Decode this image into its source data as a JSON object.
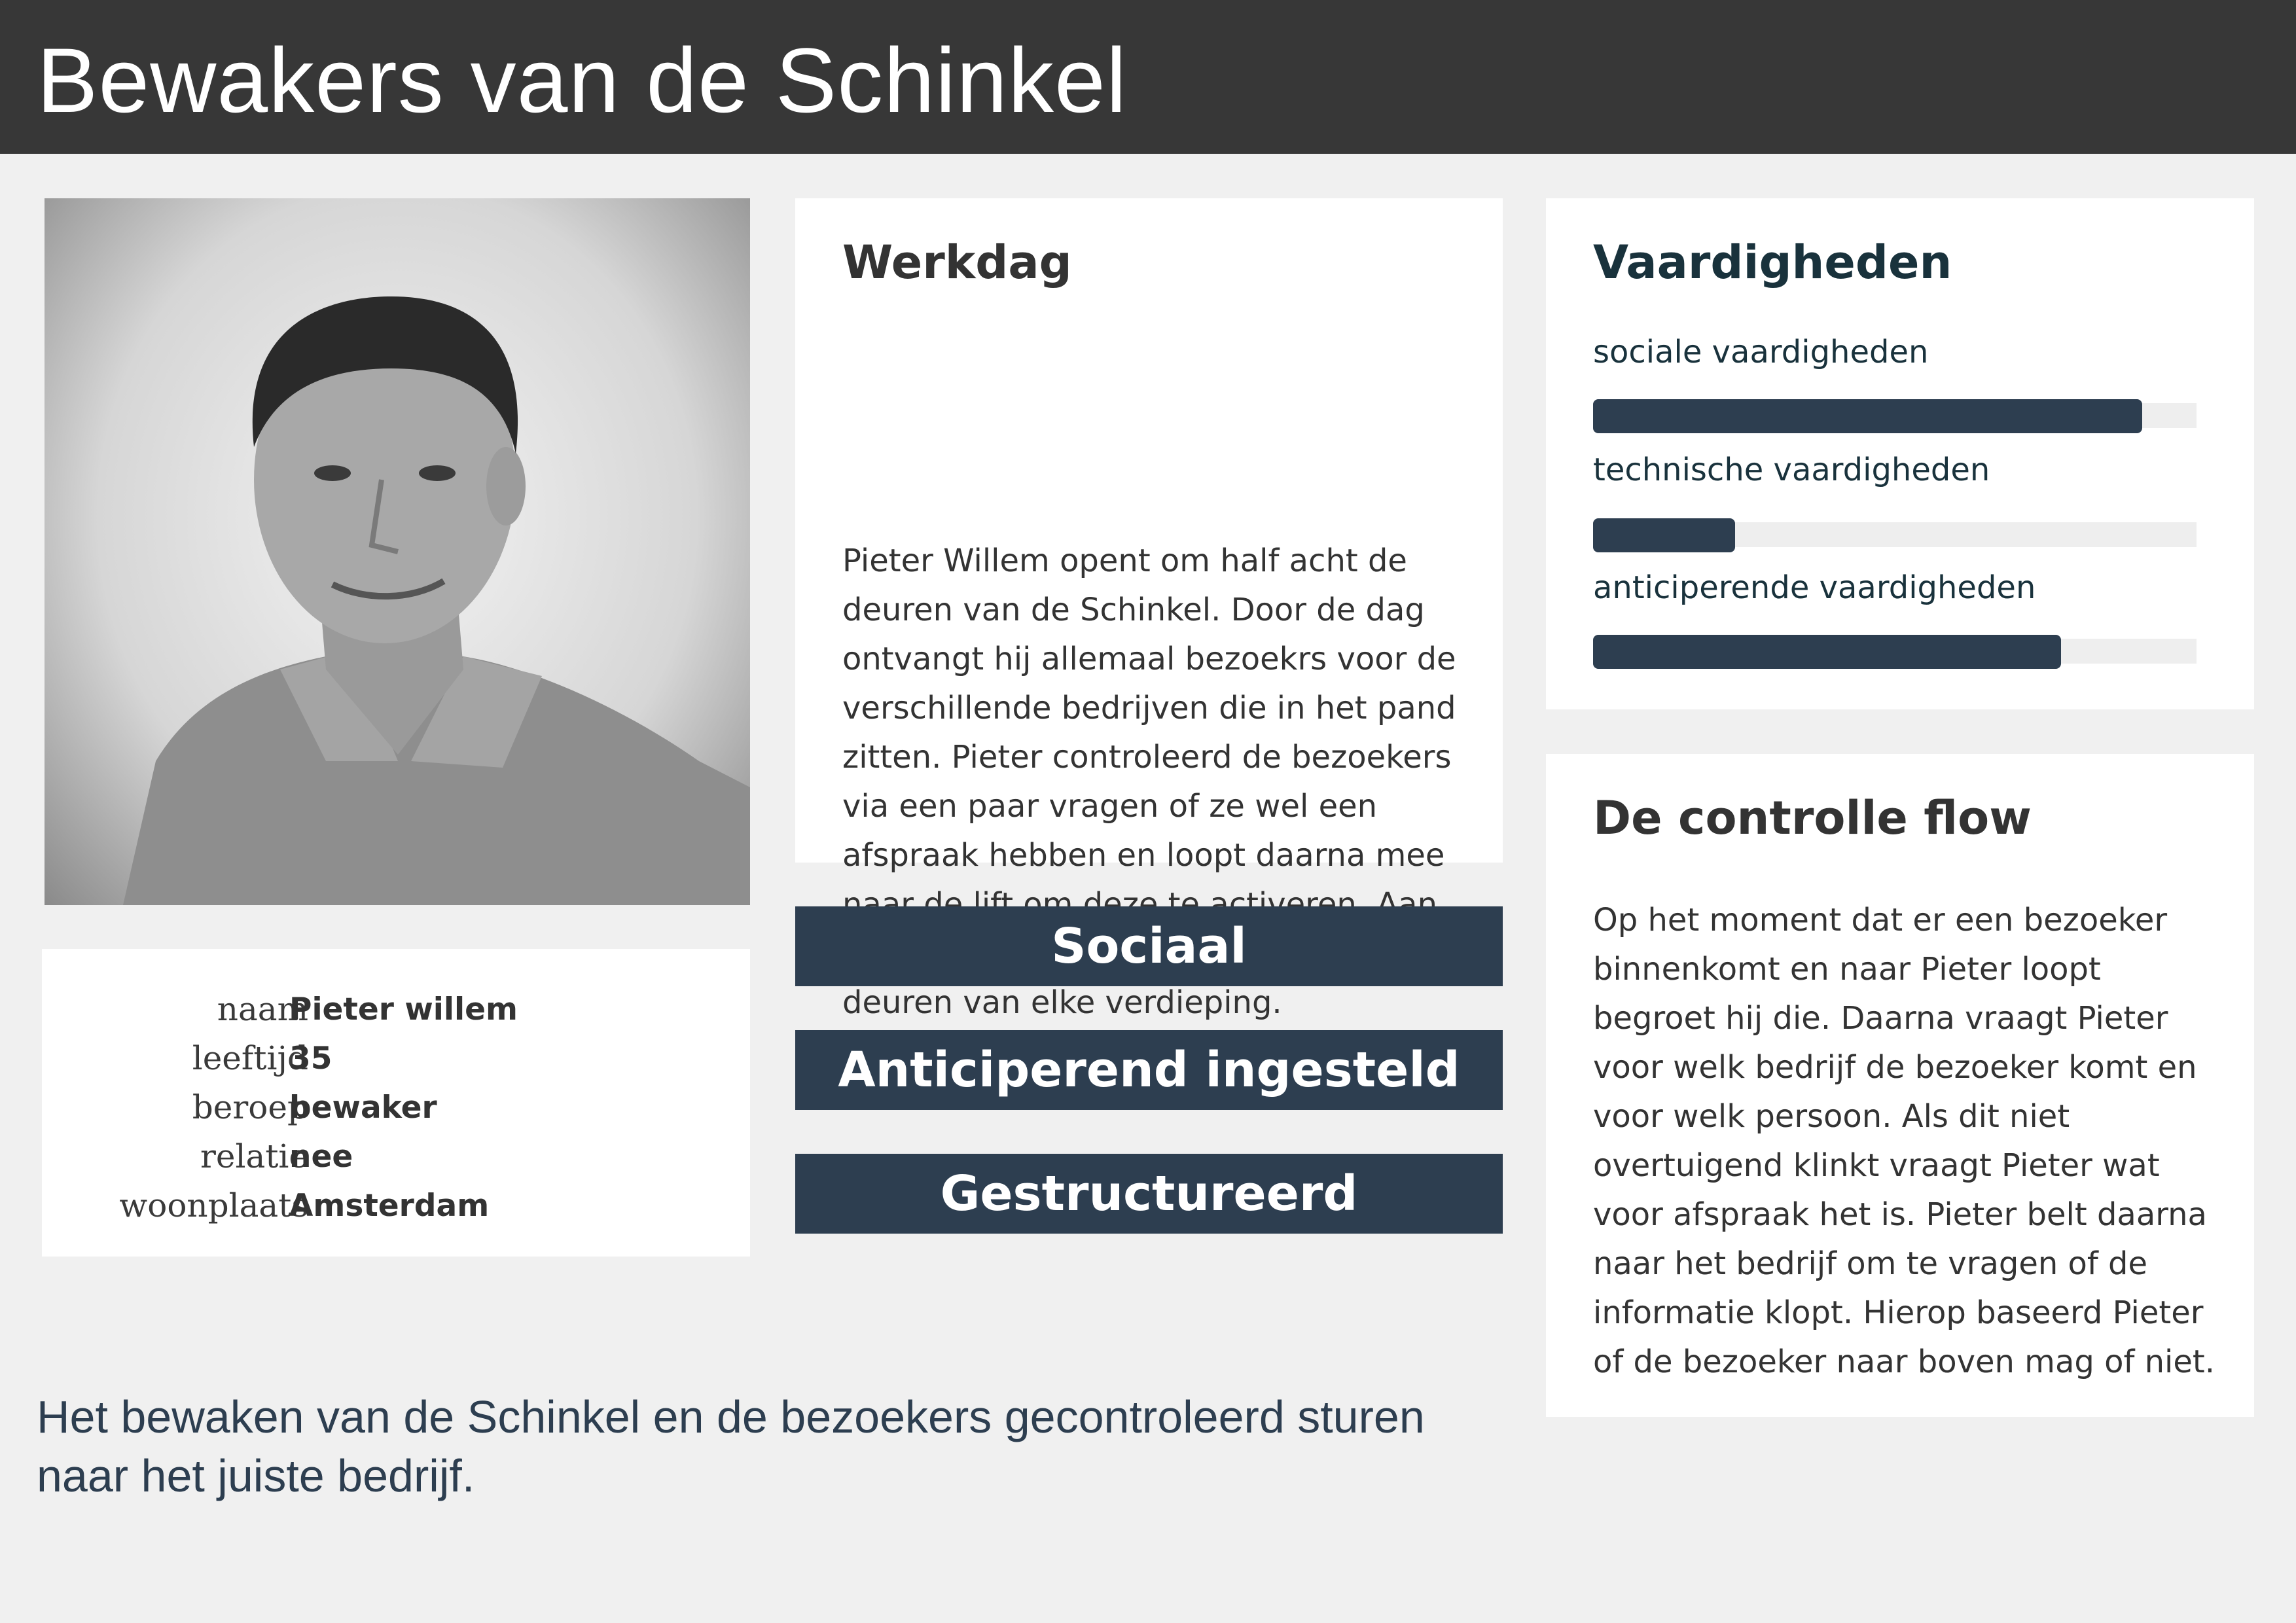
{
  "header": {
    "title": "Bewakers van de Schinkel"
  },
  "photo": {
    "subject": "portrait-photo"
  },
  "profile": {
    "rows": [
      {
        "label": "naam",
        "value": "Pieter willem"
      },
      {
        "label": "leeftijd",
        "value": "35"
      },
      {
        "label": "beroep",
        "value": "bewaker"
      },
      {
        "label": "relatie",
        "value": "nee"
      },
      {
        "label": "woonplaats",
        "value": "Amsterdam"
      }
    ]
  },
  "werkdag": {
    "title": "Werkdag",
    "text": "Pieter Willem opent om half acht de deuren van de Schinkel. Door de dag ontvangt hij allemaal bezoekrs voor de verschillende bedrijven die in het pand zitten. Pieter controleerd de bezoekers via een paar vragen of ze wel een afspraak hebben en loopt daarna mee naar de lift om deze te activeren. Aan het eind van de dag sluit Pieter alle deuren van elke verdieping."
  },
  "traits": [
    "Sociaal",
    "Anticiperend ingesteld",
    "Gestructureerd"
  ],
  "skills": {
    "title": "Vaardigheden",
    "items": [
      {
        "name": "sociale vaardigheden",
        "level": 0.91
      },
      {
        "name": "technische vaardigheden",
        "level": 0.235
      },
      {
        "name": "anticiperende vaardigheden",
        "level": 0.775
      }
    ]
  },
  "flow": {
    "title": "De controlle flow",
    "text": "Op het moment dat er een bezoeker binnenkomt en naar Pieter loopt begroet hij die. Daarna vraagt Pieter voor welk bedrijf de bezoeker komt en voor welk persoon. Als dit niet overtuigend klinkt vraagt Pieter wat voor afspraak het is. Pieter belt daarna naar het bedrijf om te vragen of de informatie klopt. Hierop baseerd Pieter of de bezoeker naar boven mag of niet."
  },
  "summary": "Het bewaken van de Schinkel en de bezoekers gecontroleerd sturen naar het juiste bedrijf.",
  "colors": {
    "header_bg": "#373737",
    "page_bg": "#f0f0f0",
    "accent": "#2d3e50",
    "skill_title": "#19323c"
  }
}
